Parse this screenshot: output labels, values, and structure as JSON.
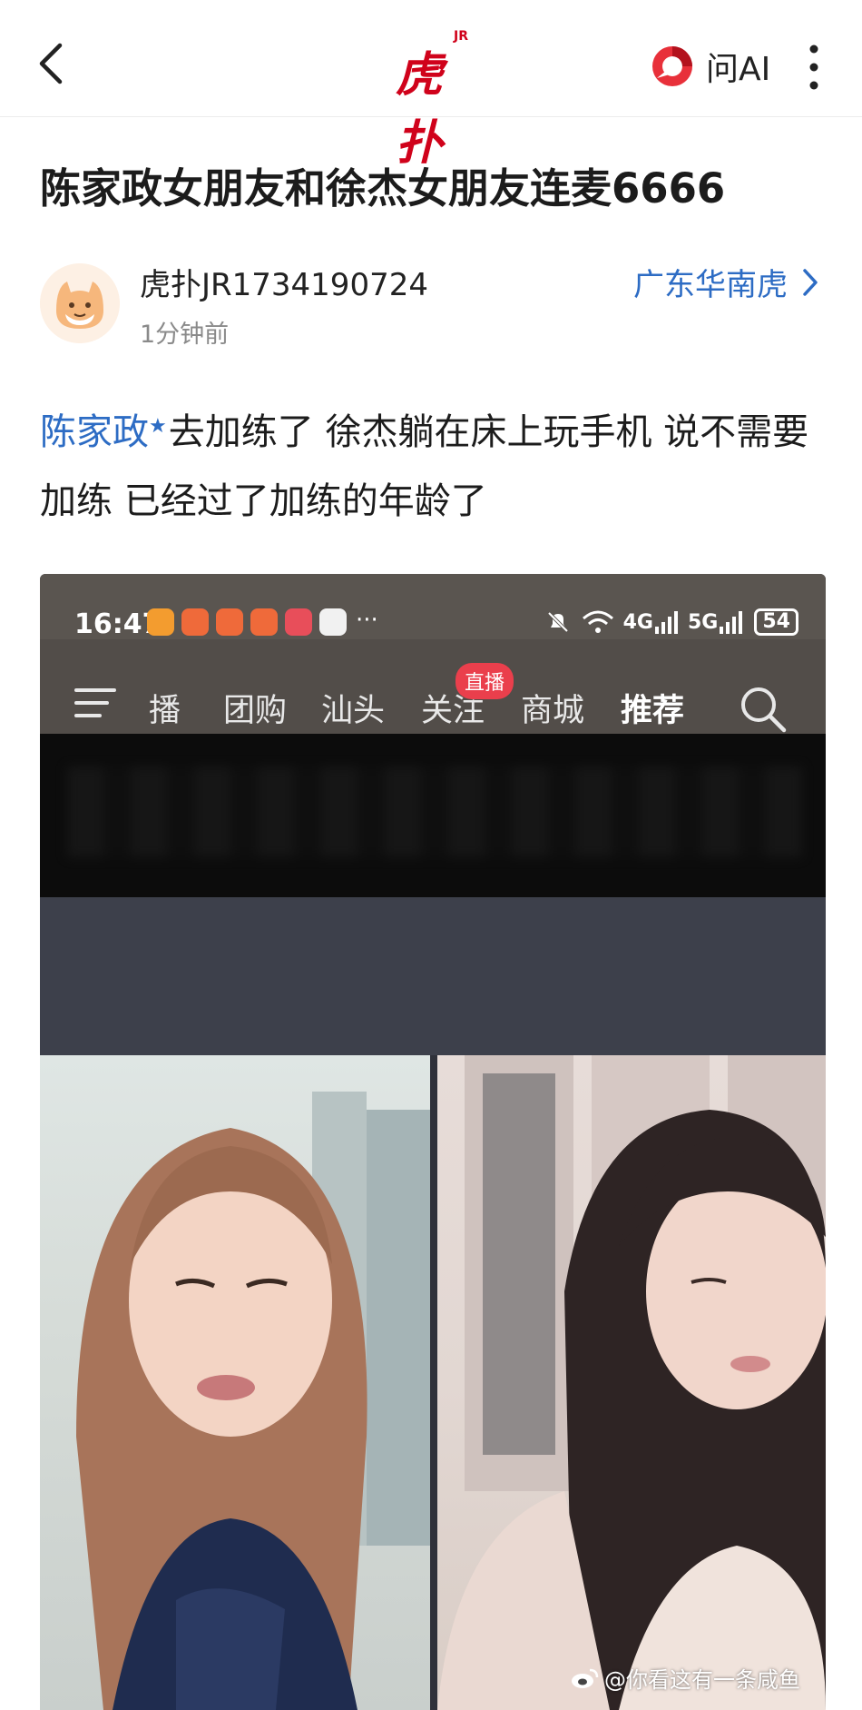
{
  "topbar": {
    "logo_text": "虎扑",
    "logo_sup": "JR",
    "ask_ai_label": "问AI"
  },
  "post": {
    "title": "陈家政女朋友和徐杰女朋友连麦6666",
    "author": "虎扑JR1734190724",
    "time": "1分钟前",
    "board": "广东华南虎",
    "mention": "陈家政",
    "body_rest": "去加练了 徐杰躺在床上玩手机 说不需要加练 已经过了加练的年龄了"
  },
  "embedded_screenshot": {
    "status_time": "16:47",
    "status_more": "···",
    "network_4g": "4G",
    "network_5g": "5G",
    "battery": "54",
    "tabs": [
      "播",
      "团购",
      "汕头",
      "关注",
      "商城",
      "推荐"
    ],
    "active_tab": "推荐",
    "live_badge": "直播",
    "watermark": "@你看这有一条咸鱼"
  },
  "colors": {
    "brand_red": "#d0021b",
    "link_blue": "#2d6cc4",
    "live_red": "#ea3f4c"
  }
}
